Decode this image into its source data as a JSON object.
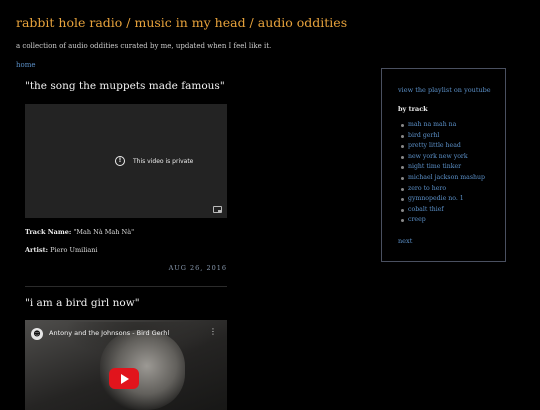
{
  "site": {
    "title": "rabbit hole radio / music in my head / audio oddities",
    "description": "a collection of audio oddities curated by me, updated when I feel like it.",
    "home_label": "home"
  },
  "posts": [
    {
      "title": "\"the song the muppets made famous\"",
      "video_message": "This video is private",
      "track_label": "Track Name:",
      "track": "\"Mah Nà Mah Nà\"",
      "artist_label": "Artist:",
      "artist": "Piero Umiliani",
      "date": "AUG 26, 2016"
    },
    {
      "title": "\"i am a bird girl now\"",
      "video_title": "Antony and the Johnsons - Bird Gerhl"
    }
  ],
  "sidebar": {
    "playlist_link": "view the playlist on youtube",
    "heading": "by track",
    "tracks": [
      "mah na mah na",
      "bird gerhl",
      "pretty little head",
      "new york new york",
      "night time tinker",
      "michael jackson mashup",
      "zero to hero",
      "gymnopedie no. 1",
      "cobalt thief",
      "creep"
    ],
    "next_label": "next"
  },
  "colors": {
    "background": "#000000",
    "title": "#e8a33c",
    "link": "#5b90c8",
    "date": "#8a9bb0",
    "youtube_red": "#e1141c"
  }
}
